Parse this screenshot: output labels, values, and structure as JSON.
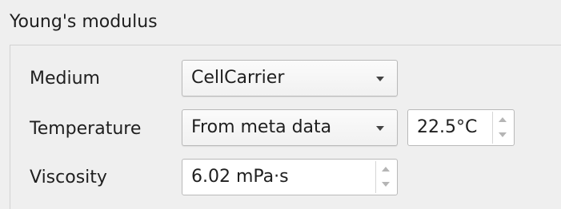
{
  "group": {
    "title": "Young's modulus"
  },
  "rows": {
    "medium": {
      "label": "Medium",
      "combo_value": "CellCarrier"
    },
    "temperature": {
      "label": "Temperature",
      "combo_value": "From meta data",
      "spin_value": "22.5°C"
    },
    "viscosity": {
      "label": "Viscosity",
      "spin_value": "6.02 mPa·s"
    }
  },
  "icons": {
    "combo_arrow": "chevron-down-icon",
    "spin_up": "spin-up-icon",
    "spin_down": "spin-down-icon"
  },
  "colors": {
    "background": "#efefef",
    "field_border": "#b9b9b9",
    "field_background": "#ffffff",
    "text": "#1f1f1f"
  }
}
